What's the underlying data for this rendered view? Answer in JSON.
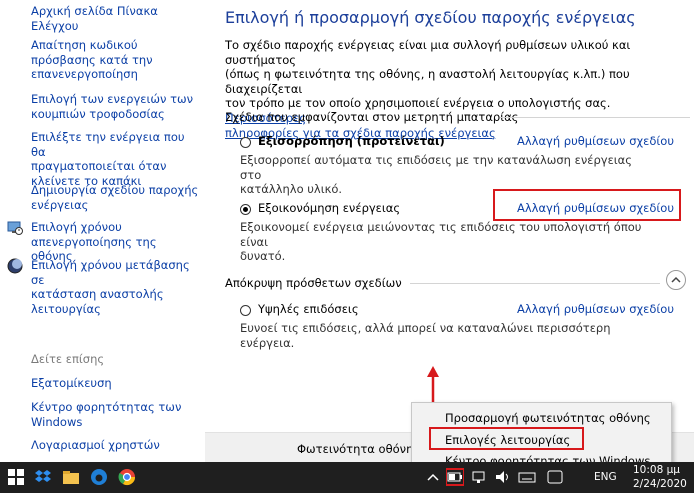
{
  "sidebar": {
    "home": "Αρχική σελίδα Πίνακα Ελέγχου",
    "links": [
      {
        "lines": [
          "Απαίτηση κωδικού",
          "πρόσβασης κατά την",
          "επανενεργοποίηση"
        ]
      },
      {
        "lines": [
          "Επιλογή των ενεργειών των",
          "κουμπιών τροφοδοσίας"
        ]
      },
      {
        "lines": [
          "Επιλέξτε την ενέργεια που θα",
          "πραγματοποιείται όταν",
          "κλείνετε το καπάκι"
        ]
      },
      {
        "lines": [
          "Δημιουργία σχεδίου παροχής",
          "ενέργειας"
        ]
      },
      {
        "lines": [
          "Επιλογή χρόνου",
          "απενεργοποίησης της οθόνης"
        ]
      },
      {
        "lines": [
          "Επιλογή χρόνου μετάβασης σε",
          "κατάσταση αναστολής",
          "λειτουργίας"
        ]
      }
    ],
    "see_also_label": "Δείτε επίσης",
    "see_also": [
      {
        "lines": [
          "Εξατομίκευση"
        ]
      },
      {
        "lines": [
          "Κέντρο φορητότητας των",
          "Windows"
        ]
      },
      {
        "lines": [
          "Λογαριασμοί χρηστών"
        ]
      }
    ]
  },
  "main": {
    "title": "Επιλογή ή προσαρμογή σχεδίου παροχής ενέργειας",
    "intro_lines": [
      "Το σχέδιο παροχής ενέργειας είναι μια συλλογή ρυθμίσεων υλικού και συστήματος",
      "(όπως η φωτεινότητα της οθόνης, η αναστολή λειτουργίας κ.λπ.) που διαχειρίζεται",
      "τον τρόπο με τον οποίο χρησιμοποιεί ενέργεια ο υπολογιστής σας."
    ],
    "intro_link_a": "Περισσότερες",
    "intro_link_b": "πληροφορίες για τα σχέδια παροχής ενέργειας",
    "battery_plans_header": "Σχέδια που εμφανίζονται στον μετρητή μπαταρίας",
    "plans": [
      {
        "name": "Εξισορρόπηση (προτείνεται)",
        "link": "Αλλαγή ρυθμίσεων σχεδίου",
        "desc": [
          "Εξισορροπεί αυτόματα τις επιδόσεις με την κατανάλωση ενέργειας στο",
          "κατάλληλο υλικό."
        ],
        "selected": false
      },
      {
        "name": "Εξοικονόμηση ενέργειας",
        "link": "Αλλαγή ρυθμίσεων σχεδίου",
        "desc": [
          "Εξοικονομεί ενέργεια μειώνοντας τις επιδόσεις του υπολογιστή όπου είναι",
          "δυνατό."
        ],
        "selected": true
      }
    ],
    "hidden_header": "Απόκρυψη πρόσθετων σχεδίων",
    "hidden_plans": [
      {
        "name": "Υψηλές επιδόσεις",
        "link": "Αλλαγή ρυθμίσεων σχεδίου",
        "desc": [
          "Ευνοεί τις επιδόσεις, αλλά μπορεί να καταναλώνει περισσότερη ενέργεια."
        ],
        "selected": false
      }
    ],
    "brightness_label": "Φωτεινότητα οθόνη"
  },
  "context_menu": {
    "items": [
      "Προσαρμογή φωτεινότητας οθόνης",
      "Επιλογές λειτουργίας",
      "Κέντρο φορητότητας των Windows"
    ]
  },
  "taskbar": {
    "language": "ENG",
    "time": "10:08 μμ",
    "date": "2/24/2020",
    "app_icons": [
      "dropbox-icon",
      "explorer-icon",
      "edge-icon",
      "chrome-icon"
    ],
    "tray_icons": [
      "up-chevron-icon",
      "battery-icon",
      "network-icon",
      "volume-icon",
      "keyboard-icon"
    ]
  },
  "colors": {
    "link": "#0b3fa6",
    "title": "#1c3f9a",
    "highlight": "#d7191c",
    "taskbar": "#1f1f1f"
  }
}
